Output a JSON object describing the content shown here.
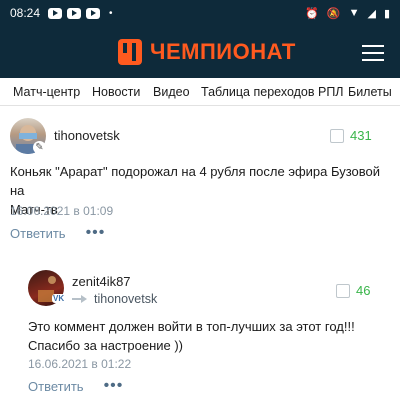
{
  "status_bar": {
    "time": "08:24",
    "dot": "•"
  },
  "app": {
    "logo_text": "ЧЕМПИОНАТ",
    "brand_color": "#ff5a1f",
    "header_color": "#0e2a3a"
  },
  "nav": {
    "items": [
      "Матч-центр",
      "Новости",
      "Видео",
      "Таблица переходов РПЛ",
      "Билеты"
    ]
  },
  "comments": [
    {
      "username": "tihonovetsk",
      "likes": "431",
      "text_line1": "Коньяк \"Арарат\" подорожал на 4 рубля после эфира Бузовой на",
      "text_line2": "Матч-тв",
      "date": "16.06.2021 в 01:09",
      "reply_label": "Ответить",
      "more_label": "•••"
    },
    {
      "username": "zenit4ik87",
      "reply_to": "tihonovetsk",
      "likes": "46",
      "text_line1": "Это коммент должен войти в топ-лучших за этот год!!!",
      "text_line2": "Спасибо за настроение ))",
      "date": "16.06.2021 в 01:22",
      "reply_label": "Ответить",
      "more_label": "•••",
      "avatar_badge": "VK"
    }
  ]
}
